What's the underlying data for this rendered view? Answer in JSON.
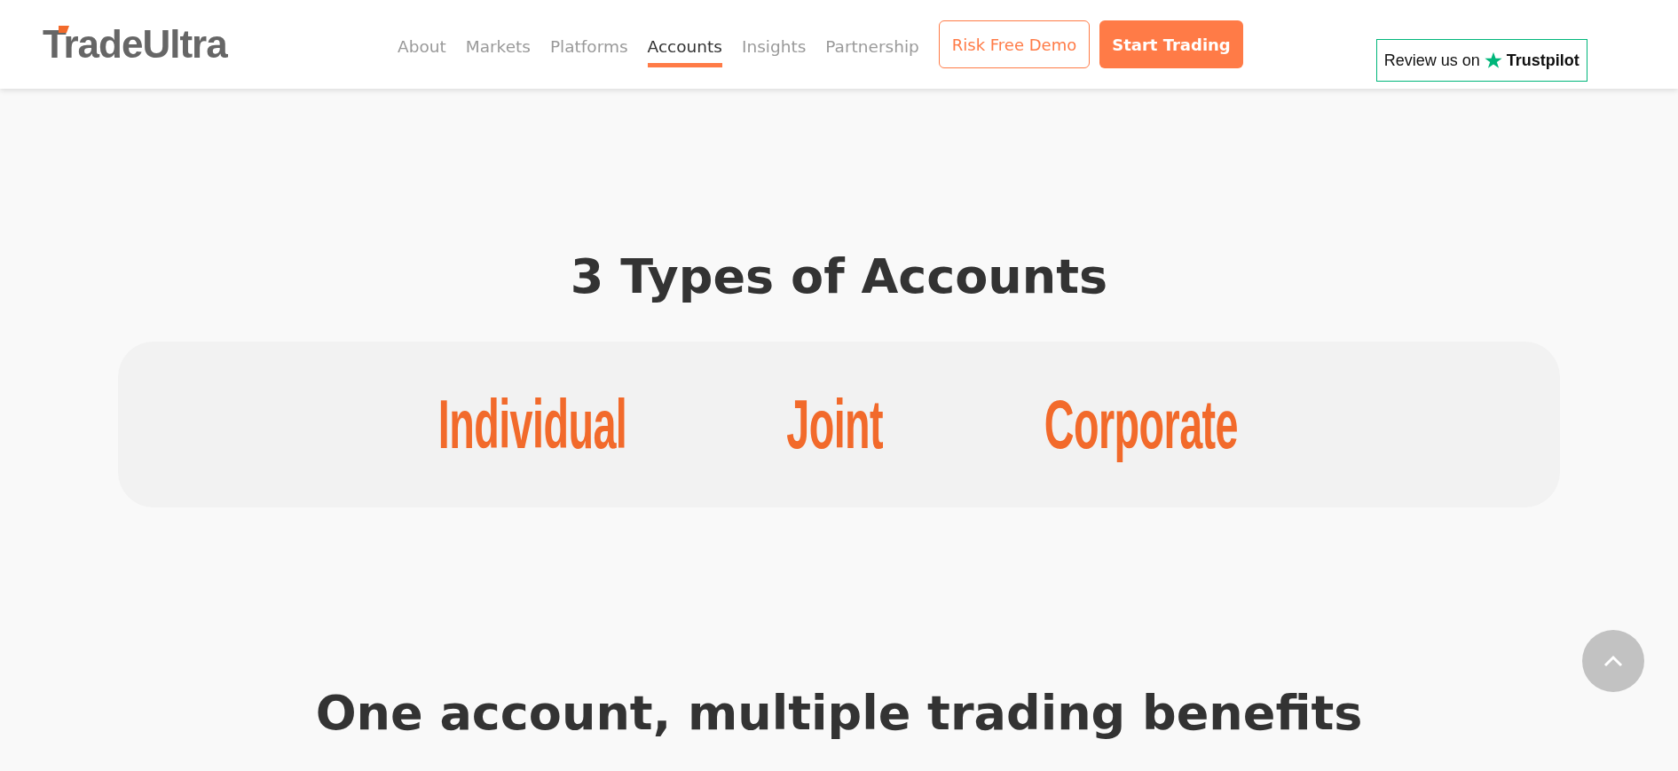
{
  "header": {
    "logo": "TradeUltra",
    "nav": [
      {
        "label": "About",
        "selected": false
      },
      {
        "label": "Markets",
        "selected": false
      },
      {
        "label": "Platforms",
        "selected": false
      },
      {
        "label": "Accounts",
        "selected": true
      },
      {
        "label": "Insights",
        "selected": false
      },
      {
        "label": "Partnership",
        "selected": false
      }
    ],
    "buttons": [
      {
        "label": "Risk Free Demo",
        "kind": "outline"
      },
      {
        "label": "Start Trading",
        "kind": "filled"
      }
    ],
    "review": {
      "text": "Review us on",
      "brand": "Trustpilot"
    }
  },
  "types": {
    "title": "3 Types of Accounts",
    "items": [
      "Individual",
      "Joint",
      "Corporate"
    ]
  },
  "benefits": {
    "title": "One account, multiple trading benefits"
  }
}
